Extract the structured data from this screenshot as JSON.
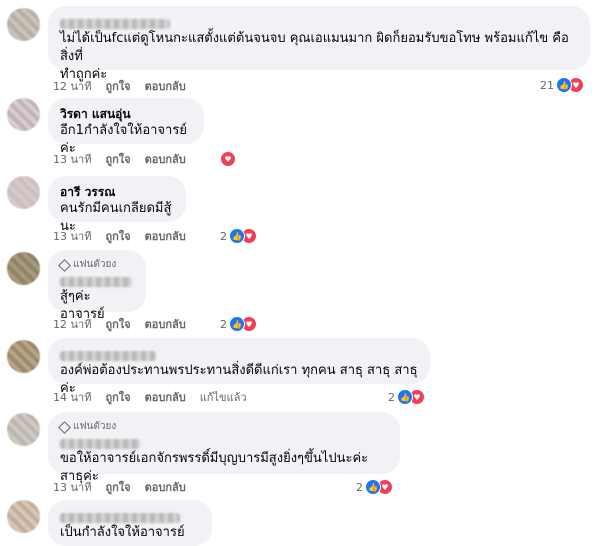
{
  "labels": {
    "like": "ถูกใจ",
    "reply": "ตอบกลับ",
    "edited": "แก้ไขแล้ว",
    "badge": "แฟนตัวยง"
  },
  "comments": [
    {
      "text_line1": "ไม่ได้เป็นfcแต่ดูโหนกะแสตั้งแต่ต้นจนจบ คุณเอแมนมาก ผิดก็ยอมรับขอโทษ พร้อมแก้ไข คือสิ่งที่",
      "text_line2": "ทำถูกค่ะ",
      "time": "12 นาที",
      "react_count": "21"
    },
    {
      "name": "วิรดา แสนอุ่น",
      "text": "อีก1กำลังใจให้อาจารย์ค่ะ",
      "time": "13 นาที"
    },
    {
      "name": "อารี วรรณ",
      "text": "คนรักมีคนเกลียดมีสู้นะ",
      "time": "13 นาที",
      "react_count": "2"
    },
    {
      "text": "สู้ๆค่ะอาจารย์",
      "time": "12 นาที",
      "react_count": "2"
    },
    {
      "text": "องค์พ่อต้องประทานพรประทานสิ่งดีดีแก่เรา ทุกคน สาธุ สาธุ สาธุ ค่ะ",
      "time": "14 นาที",
      "react_count": "2"
    },
    {
      "text": "ขอให้อาจารย์เอกจักรพรรดิ์มีบุญบารมีสูงยิ่งๆขึ้นไปนะค่ะสาธุค่ะ",
      "time": "13 นาที",
      "react_count": "2"
    },
    {
      "text": "เป็นกำลังใจให้อาจารย์นะคะ"
    }
  ],
  "colors": {
    "bubble": "#f0f2f5",
    "like": "#1877f2",
    "love": "#f33e58",
    "meta": "#65676b"
  }
}
